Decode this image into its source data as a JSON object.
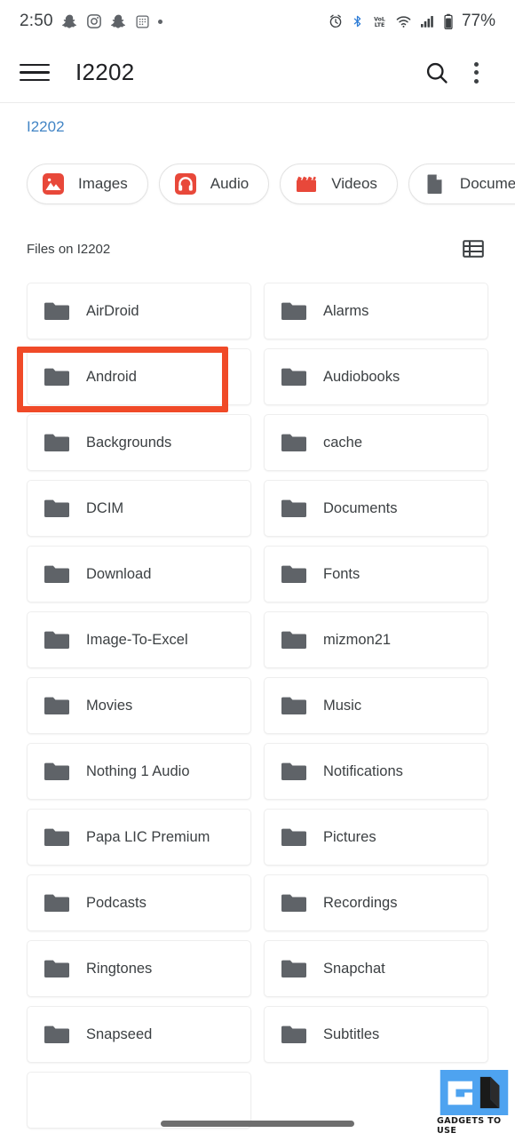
{
  "status_bar": {
    "time": "2:50",
    "left_icons": [
      "snapchat-icon",
      "instagram-icon",
      "snapchat-icon",
      "keypad-icon",
      "more-dot-icon"
    ],
    "right_icons": [
      "alarm-icon",
      "bluetooth-icon",
      "volte-icon",
      "wifi-icon",
      "signal-icon",
      "battery-icon"
    ],
    "battery_percent": "77%",
    "volte_label_top": "VoL",
    "volte_label_bottom": "LTE"
  },
  "app_bar": {
    "menu_icon": "hamburger-menu-icon",
    "title": "I2202",
    "search_icon": "search-icon",
    "overflow_icon": "more-vert-icon"
  },
  "breadcrumb": {
    "items": [
      {
        "label": "I2202"
      }
    ]
  },
  "filter_chips": [
    {
      "label": "Images",
      "icon": "image-icon",
      "color": "#e8483a"
    },
    {
      "label": "Audio",
      "icon": "headphone-icon",
      "color": "#e8483a"
    },
    {
      "label": "Videos",
      "icon": "clapper-icon",
      "color": "#e8483a"
    },
    {
      "label": "Documents",
      "icon": "document-icon",
      "color": "#5f6368"
    },
    {
      "label": "",
      "icon": "partial-chip",
      "color": "#5f6368"
    }
  ],
  "section": {
    "title": "Files on I2202",
    "view_toggle_icon": "list-view-icon"
  },
  "folders": [
    {
      "name": "AirDroid"
    },
    {
      "name": "Alarms"
    },
    {
      "name": "Android",
      "highlighted": true
    },
    {
      "name": "Audiobooks"
    },
    {
      "name": "Backgrounds"
    },
    {
      "name": "cache"
    },
    {
      "name": "DCIM"
    },
    {
      "name": "Documents"
    },
    {
      "name": "Download"
    },
    {
      "name": "Fonts"
    },
    {
      "name": "Image-To-Excel"
    },
    {
      "name": "mizmon21"
    },
    {
      "name": "Movies"
    },
    {
      "name": "Music"
    },
    {
      "name": "Nothing 1 Audio"
    },
    {
      "name": "Notifications"
    },
    {
      "name": "Papa LIC Premium"
    },
    {
      "name": "Pictures"
    },
    {
      "name": "Podcasts"
    },
    {
      "name": "Recordings"
    },
    {
      "name": "Ringtones"
    },
    {
      "name": "Snapchat"
    },
    {
      "name": "Snapseed"
    },
    {
      "name": "Subtitles"
    },
    {
      "name": ""
    }
  ],
  "annotation": {
    "color": "#f04a28",
    "target": "Android"
  },
  "watermark": {
    "text": "GADGETS TO USE",
    "accent": "#4ea3f0"
  },
  "navigation": {
    "gesture_pill": "home-gesture-pill"
  },
  "theme": {
    "background": "#ffffff",
    "text_primary": "#3c4043",
    "link": "#4285c5",
    "folder_gray": "#5f6368",
    "chip_red": "#e8483a"
  }
}
